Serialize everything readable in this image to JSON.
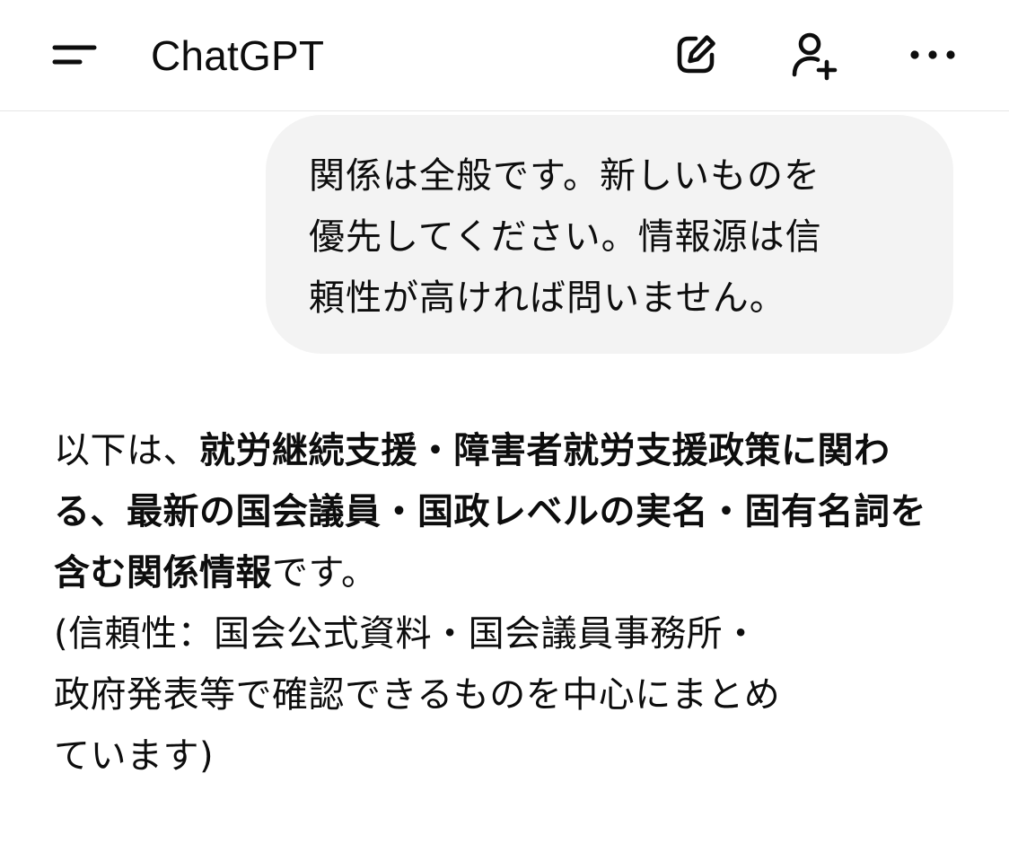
{
  "header": {
    "title": "ChatGPT",
    "icons": {
      "menu": "menu-icon",
      "new_chat": "edit-icon",
      "add_user": "add-user-icon",
      "more": "more-icon"
    }
  },
  "user_message": {
    "lines": [
      "関係は全般です。新しいものを",
      "優先してください。情報源は信",
      "頼性が高ければ問いません。"
    ]
  },
  "assistant_message": {
    "intro_plain": "以下は、",
    "intro_bold": "就労継続支援・障害者就労支援政策に関わる、最新の国会議員・国政レベルの実名・固有名詞を含む関係情報",
    "intro_end": "です。",
    "note_lines": [
      "(信頼性：国会公式資料・国会議員事務所・",
      "政府発表等で確認できるものを中心にまとめ",
      "ています)"
    ]
  },
  "colors": {
    "text": "#0d0d0d",
    "bubble": "#f3f3f3",
    "divider": "#e6e6e6"
  }
}
